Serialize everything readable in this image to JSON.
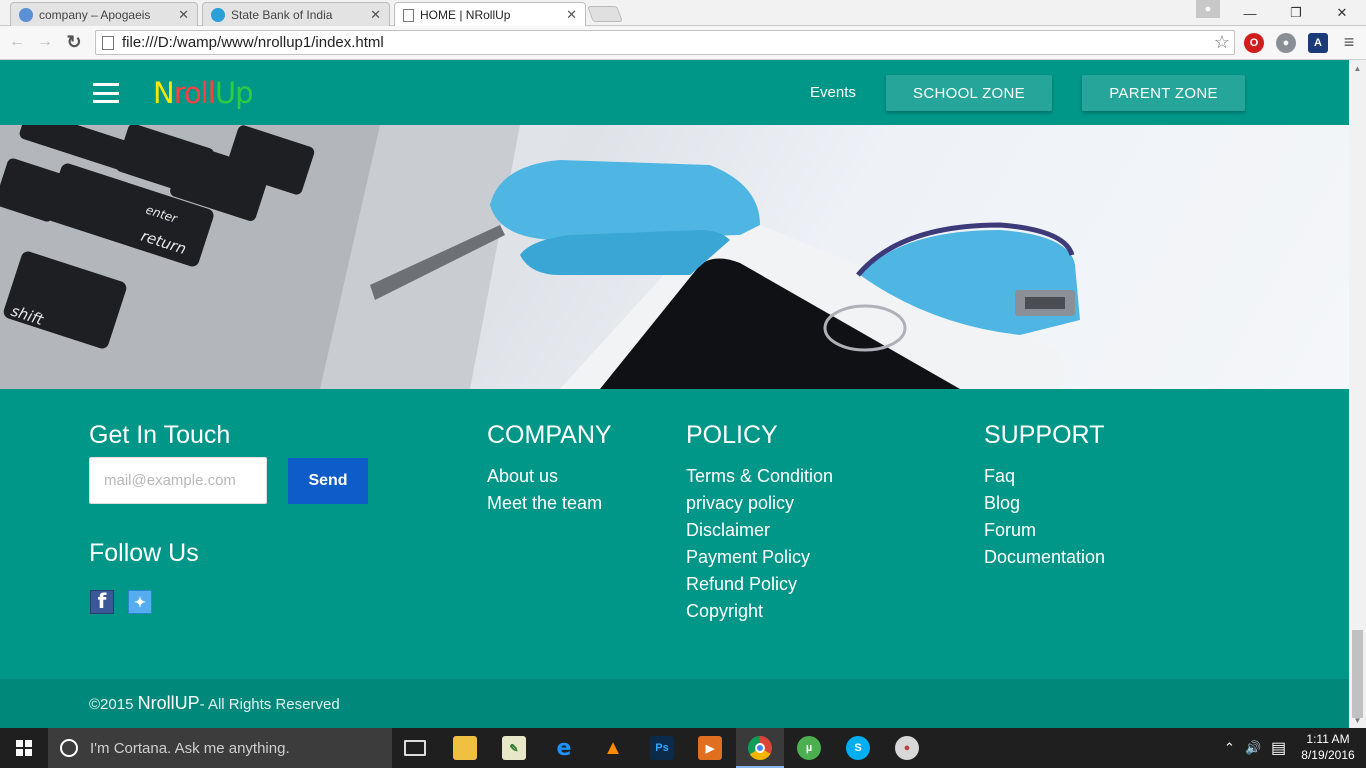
{
  "browser": {
    "tabs": [
      {
        "title": "company – Apogaeis",
        "active": false,
        "favicon_color": "#5b8fd6"
      },
      {
        "title": "State Bank of India",
        "active": false,
        "favicon_color": "#2a9fd8"
      },
      {
        "title": "HOME | NRollUp",
        "active": true,
        "favicon_color": "#ffffff"
      }
    ],
    "close_glyph": "✕",
    "url": "file:///D:/wamp/www/nrollup1/index.html",
    "window_controls": {
      "minimize": "—",
      "restore": "❐",
      "close": "✕"
    }
  },
  "site": {
    "logo": {
      "part1": "N",
      "part2": "ro",
      "part3": "ll",
      "part4": "Up"
    },
    "nav": {
      "events": "Events",
      "school_zone": "SCHOOL ZONE",
      "parent_zone": "PARENT ZONE"
    },
    "colors": {
      "primary": "#009688",
      "accent_button": "#26a69a",
      "send_button": "#0d5cc8",
      "bottom_bar": "#00897b"
    }
  },
  "footer": {
    "get_in_touch": {
      "heading": "Get In Touch",
      "email_placeholder": "mail@example.com",
      "send_label": "Send"
    },
    "follow_us": {
      "heading": "Follow Us",
      "icons": [
        "facebook-icon",
        "twitter-icon"
      ]
    },
    "company": {
      "heading": "COMPANY",
      "links": [
        "About us",
        "Meet the team"
      ]
    },
    "policy": {
      "heading": "POLICY",
      "links": [
        "Terms & Condition",
        "privacy policy",
        "Disclaimer",
        "Payment Policy",
        "Refund Policy",
        "Copyright"
      ]
    },
    "support": {
      "heading": "SUPPORT",
      "links": [
        "Faq",
        "Blog",
        "Forum",
        "Documentation"
      ]
    },
    "copyright": {
      "prefix": "©2015 ",
      "brand": "NrollUP",
      "suffix": "- All Rights Reserved"
    }
  },
  "taskbar": {
    "cortana_placeholder": "I'm Cortana. Ask me anything.",
    "time": "1:11 AM",
    "date": "8/19/2016"
  }
}
